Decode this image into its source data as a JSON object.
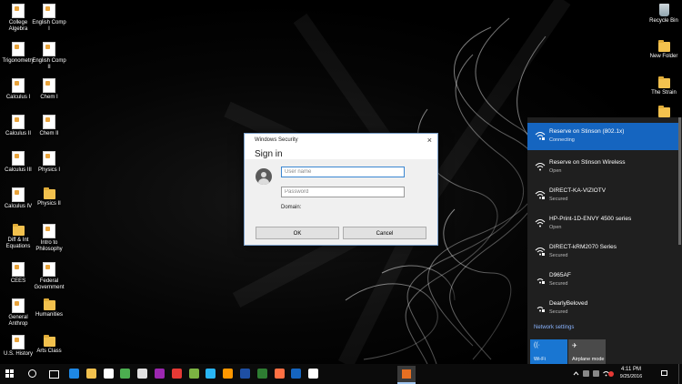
{
  "desktop": {
    "left_icons": [
      {
        "label": "College Algebra",
        "kind": "doc"
      },
      {
        "label": "English Comp I",
        "kind": "doc"
      },
      {
        "label": "Trigonometry",
        "kind": "doc"
      },
      {
        "label": "English Comp II",
        "kind": "doc"
      },
      {
        "label": "Calculus I",
        "kind": "doc"
      },
      {
        "label": "Chem I",
        "kind": "doc"
      },
      {
        "label": "Calculus II",
        "kind": "doc"
      },
      {
        "label": "Chem II",
        "kind": "doc"
      },
      {
        "label": "Calculus III",
        "kind": "doc"
      },
      {
        "label": "Physics I",
        "kind": "doc"
      },
      {
        "label": "Calculus IV",
        "kind": "doc"
      },
      {
        "label": "Physics II",
        "kind": "folder"
      },
      {
        "label": "Diff & Int Equations",
        "kind": "folder"
      },
      {
        "label": "Intro to Philosophy",
        "kind": "doc"
      },
      {
        "label": "CEES",
        "kind": "doc"
      },
      {
        "label": "Federal Government",
        "kind": "doc"
      },
      {
        "label": "General Anthrop",
        "kind": "doc"
      },
      {
        "label": "Humanities",
        "kind": "folder"
      },
      {
        "label": "U.S. History",
        "kind": "doc"
      },
      {
        "label": "Arts Class",
        "kind": "folder"
      }
    ],
    "right_icons": [
      {
        "label": "Recycle Bin",
        "kind": "bin"
      },
      {
        "label": "New Folder",
        "kind": "folder"
      },
      {
        "label": "The Strain",
        "kind": "folder"
      },
      {
        "label": "",
        "kind": "folder"
      }
    ]
  },
  "dialog": {
    "window_title": "Windows Security",
    "close_glyph": "×",
    "heading": "Sign in",
    "username_placeholder": "User name",
    "password_placeholder": "Password",
    "domain_label": "Domain:",
    "ok_label": "OK",
    "cancel_label": "Cancel"
  },
  "network_flyout": {
    "networks": [
      {
        "name": "Reserve on Stinson (802.1x)",
        "status": "Connecting",
        "active": true,
        "icon": "wifi-secured-icon"
      },
      {
        "name": "Reserve on Stinson Wireless",
        "status": "Open",
        "active": false,
        "icon": "wifi-open-icon"
      },
      {
        "name": "DIRECT-KA-VIZIOTV",
        "status": "Secured",
        "active": false,
        "icon": "wifi-secured-icon"
      },
      {
        "name": "HP-Print-1D-ENVY 4500 series",
        "status": "Open",
        "active": false,
        "icon": "wifi-open-icon"
      },
      {
        "name": "DIRECT-kRM2070 Series",
        "status": "Secured",
        "active": false,
        "icon": "wifi-secured-icon"
      },
      {
        "name": "D965AF",
        "status": "Secured",
        "active": false,
        "icon": "wifi-secured-icon"
      },
      {
        "name": "DearlyBeloved",
        "status": "Secured",
        "active": false,
        "icon": "wifi-secured-icon"
      }
    ],
    "settings_link": "Network settings",
    "tiles": [
      {
        "label": "Wi-Fi",
        "glyph": "((·",
        "active": true
      },
      {
        "label": "Airplane mode",
        "glyph": "✈",
        "active": false
      }
    ]
  },
  "taskbar": {
    "apps": [
      {
        "name": "edge-icon",
        "color": "#1e88e5"
      },
      {
        "name": "file-explorer-icon",
        "color": "#f2c14e"
      },
      {
        "name": "store-icon",
        "color": "#ffffff"
      },
      {
        "name": "calculator-icon",
        "color": "#4caf50"
      },
      {
        "name": "paint-icon",
        "color": "#e0e0e0"
      },
      {
        "name": "media-icon",
        "color": "#9c27b0"
      },
      {
        "name": "chrome-icon",
        "color": "#e53935"
      },
      {
        "name": "utorrent-icon",
        "color": "#7cb342"
      },
      {
        "name": "skype-icon",
        "color": "#29b6f6"
      },
      {
        "name": "vlc-icon",
        "color": "#ff9800"
      },
      {
        "name": "word-icon",
        "color": "#1e4fa3"
      },
      {
        "name": "excel-icon",
        "color": "#2e7d32"
      },
      {
        "name": "photos-icon",
        "color": "#ff7043"
      },
      {
        "name": "app-icon",
        "color": "#1565c0"
      },
      {
        "name": "usb-icon",
        "color": "#ffffff"
      }
    ],
    "clock_time": "4:11 PM",
    "clock_date": "9/25/2016"
  },
  "colors": {
    "accent": "#1565c0",
    "flyout_bg": "#1f1f1f",
    "link": "#8ab4ff"
  }
}
